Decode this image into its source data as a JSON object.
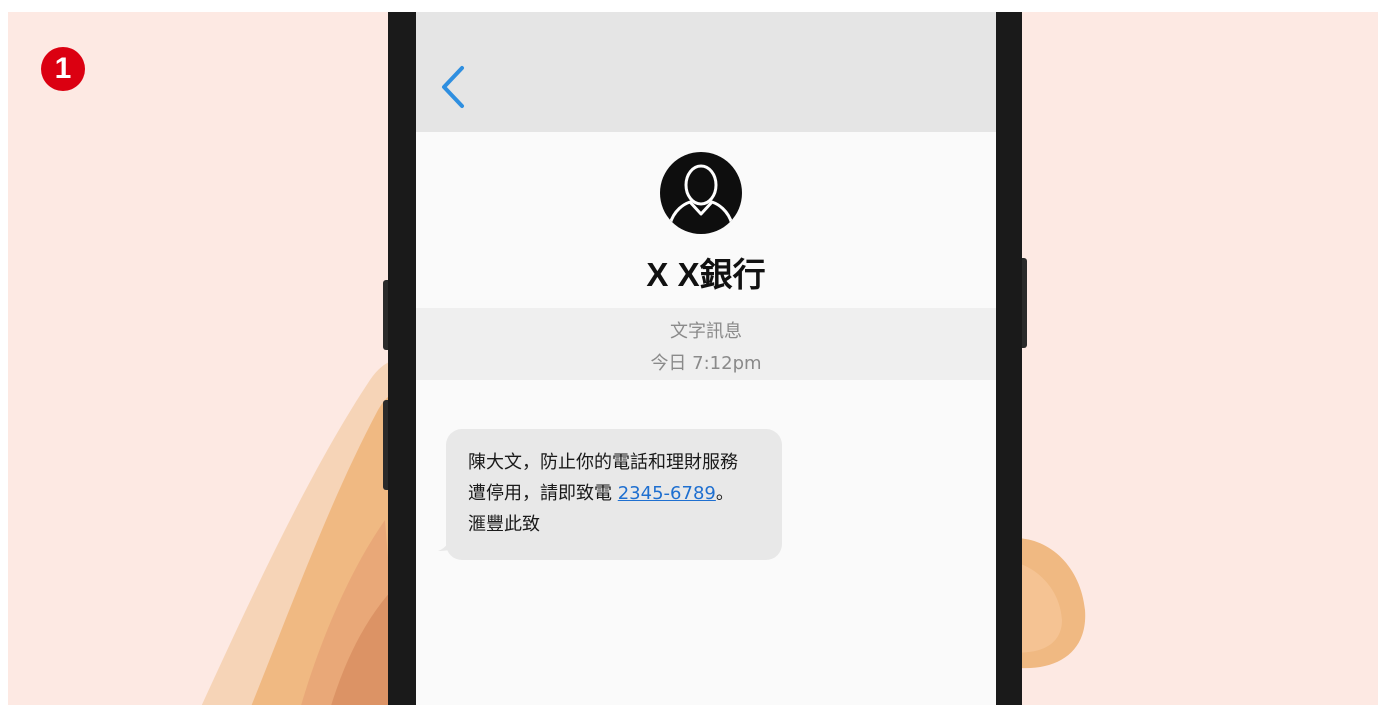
{
  "step_number": "1",
  "conversation": {
    "contact_name": "X X銀行",
    "message_type": "文字訊息",
    "timestamp": "今日 7:12pm",
    "message": {
      "line1": "陳大文，防止你的電話和理財服務",
      "line2_prefix": "遭停用，請即致電 ",
      "phone_link": "2345-6789",
      "line2_suffix": "。",
      "line3": "滙豐此致"
    }
  },
  "icons": {
    "back": "chevron-left-icon",
    "avatar": "person-avatar-icon"
  },
  "colors": {
    "background": "#fde9e3",
    "step_badge": "#db0011",
    "back_chevron": "#2f8fe0",
    "link": "#1e6fd0",
    "bubble": "#e8e8e8"
  }
}
